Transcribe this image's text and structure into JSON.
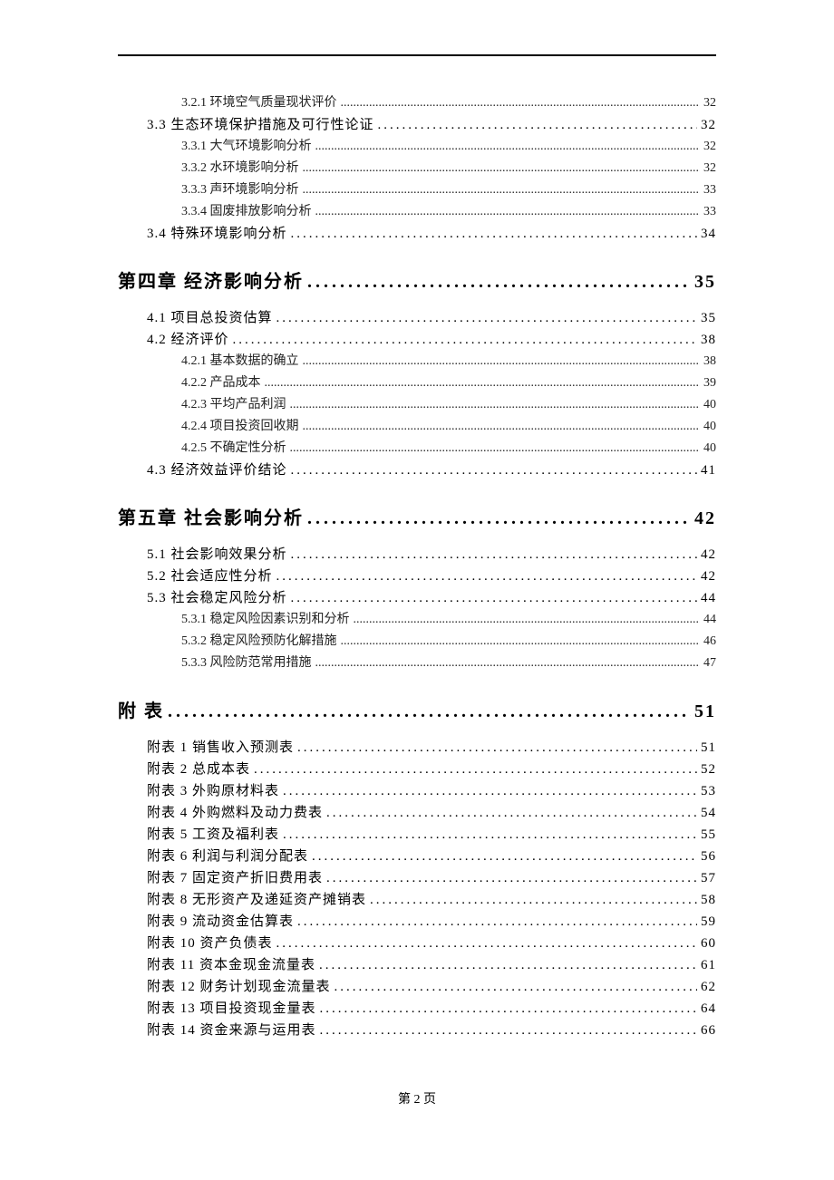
{
  "footer": "第 2 页",
  "toc": [
    {
      "level": "sub",
      "label": "3.2.1  环境空气质量现状评价",
      "page": "32"
    },
    {
      "level": "section",
      "label": "3.3 生态环境保护措施及可行性论证",
      "page": "32"
    },
    {
      "level": "sub",
      "label": "3.3.1  大气环境影响分析",
      "page": "32"
    },
    {
      "level": "sub",
      "label": "3.3.2  水环境影响分析",
      "page": "32"
    },
    {
      "level": "sub",
      "label": "3.3.3  声环境影响分析",
      "page": "33"
    },
    {
      "level": "sub",
      "label": "3.3.4  固废排放影响分析",
      "page": "33"
    },
    {
      "level": "section",
      "label": "3.4 特殊环境影响分析",
      "page": "34"
    },
    {
      "level": "chapter",
      "label": "第四章  经济影响分析",
      "page": "35"
    },
    {
      "level": "section",
      "label": "4.1 项目总投资估算",
      "page": "35"
    },
    {
      "level": "section",
      "label": "4.2 经济评价",
      "page": "38"
    },
    {
      "level": "sub",
      "label": "4.2.1 基本数据的确立",
      "page": "38"
    },
    {
      "level": "sub",
      "label": "4.2.2 产品成本",
      "page": "39"
    },
    {
      "level": "sub",
      "label": "4.2.3 平均产品利润",
      "page": "40"
    },
    {
      "level": "sub",
      "label": "4.2.4 项目投资回收期",
      "page": "40"
    },
    {
      "level": "sub",
      "label": "4.2.5 不确定性分析",
      "page": "40"
    },
    {
      "level": "section",
      "label": "4.3 经济效益评价结论",
      "page": "41"
    },
    {
      "level": "chapter",
      "label": "第五章  社会影响分析",
      "page": "42"
    },
    {
      "level": "section",
      "label": "5.1 社会影响效果分析",
      "page": "42"
    },
    {
      "level": "section",
      "label": "5.2 社会适应性分析",
      "page": "42"
    },
    {
      "level": "section",
      "label": "5.3 社会稳定风险分析",
      "page": "44"
    },
    {
      "level": "sub",
      "label": "5.3.1  稳定风险因素识别和分析",
      "page": "44"
    },
    {
      "level": "sub",
      "label": "5.3.2  稳定风险预防化解措施",
      "page": "46"
    },
    {
      "level": "sub",
      "label": "5.3.3  风险防范常用措施",
      "page": "47"
    },
    {
      "level": "chapter",
      "label": "附  表",
      "page": "51"
    },
    {
      "level": "section",
      "label": "附表 1  销售收入预测表",
      "page": "51"
    },
    {
      "level": "section",
      "label": "附表 2  总成本表",
      "page": "52"
    },
    {
      "level": "section",
      "label": "附表 3  外购原材料表",
      "page": "53"
    },
    {
      "level": "section",
      "label": "附表 4  外购燃料及动力费表",
      "page": "54"
    },
    {
      "level": "section",
      "label": "附表 5  工资及福利表",
      "page": "55"
    },
    {
      "level": "section",
      "label": "附表 6  利润与利润分配表",
      "page": "56"
    },
    {
      "level": "section",
      "label": "附表 7  固定资产折旧费用表",
      "page": "57"
    },
    {
      "level": "section",
      "label": "附表 8  无形资产及递延资产摊销表",
      "page": "58"
    },
    {
      "level": "section",
      "label": "附表 9  流动资金估算表",
      "page": "59"
    },
    {
      "level": "section",
      "label": "附表 10  资产负债表",
      "page": "60"
    },
    {
      "level": "section",
      "label": "附表 11  资本金现金流量表",
      "page": "61"
    },
    {
      "level": "section",
      "label": "附表 12  财务计划现金流量表",
      "page": "62"
    },
    {
      "level": "section",
      "label": "附表 13  项目投资现金量表",
      "page": "64"
    },
    {
      "level": "section",
      "label": "附表 14  资金来源与运用表",
      "page": "66"
    }
  ]
}
